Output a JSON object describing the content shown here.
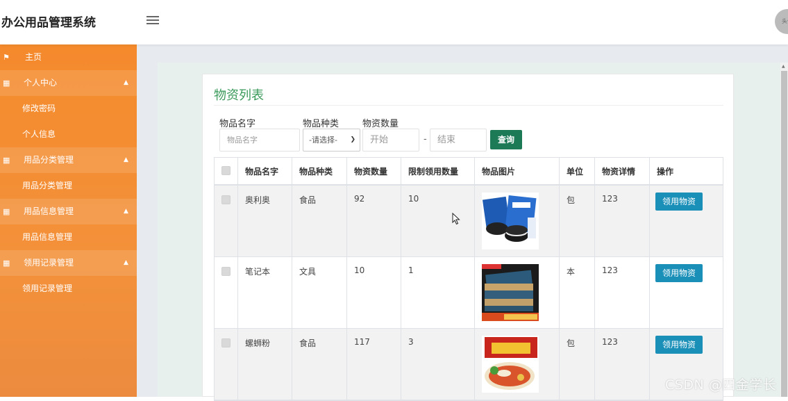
{
  "app": {
    "title": "办公用品管理系统",
    "avatar_text": "头像"
  },
  "sidebar": {
    "items": [
      {
        "label": "主页",
        "icon": "flag-icon",
        "type": "home"
      },
      {
        "label": "个人中心",
        "icon": "grid-icon",
        "type": "group"
      },
      {
        "label": "修改密码",
        "type": "sub"
      },
      {
        "label": "个人信息",
        "type": "sub"
      },
      {
        "label": "用品分类管理",
        "icon": "grid-icon",
        "type": "group"
      },
      {
        "label": "用品分类管理",
        "type": "sub"
      },
      {
        "label": "用品信息管理",
        "icon": "grid-icon",
        "type": "group"
      },
      {
        "label": "用品信息管理",
        "type": "sub"
      },
      {
        "label": "领用记录管理",
        "icon": "grid-icon",
        "type": "group"
      },
      {
        "label": "领用记录管理",
        "type": "sub"
      }
    ]
  },
  "card": {
    "title": "物资列表",
    "filters": {
      "name_label": "物品名字",
      "name_placeholder": "物品名字",
      "category_label": "物品种类",
      "category_selected": "-请选择-",
      "quantity_label": "物资数量",
      "start_placeholder": "开始",
      "dash": "-",
      "end_placeholder": "结束",
      "query_button": "查询"
    },
    "table": {
      "headers": [
        "物品名字",
        "物品种类",
        "物资数量",
        "限制领用数量",
        "物品图片",
        "单位",
        "物资详情",
        "操作"
      ],
      "rows": [
        {
          "name": "奥利奥",
          "category": "食品",
          "quantity": "92",
          "limit": "10",
          "unit": "包",
          "detail": "123",
          "action": "领用物资",
          "image": "oreo-image"
        },
        {
          "name": "笔记本",
          "category": "文具",
          "quantity": "10",
          "limit": "1",
          "unit": "本",
          "detail": "123",
          "action": "领用物资",
          "image": "notebook-image"
        },
        {
          "name": "螺蛳粉",
          "category": "食品",
          "quantity": "117",
          "limit": "3",
          "unit": "包",
          "detail": "123",
          "action": "领用物资",
          "image": "luosifen-image"
        }
      ]
    }
  },
  "watermark": "CSDN @四金学长",
  "colors": {
    "sidebar": "#f48a2c",
    "query_button": "#1d7a57",
    "action_button": "#1a8fb8",
    "title": "#3a9a5a"
  }
}
